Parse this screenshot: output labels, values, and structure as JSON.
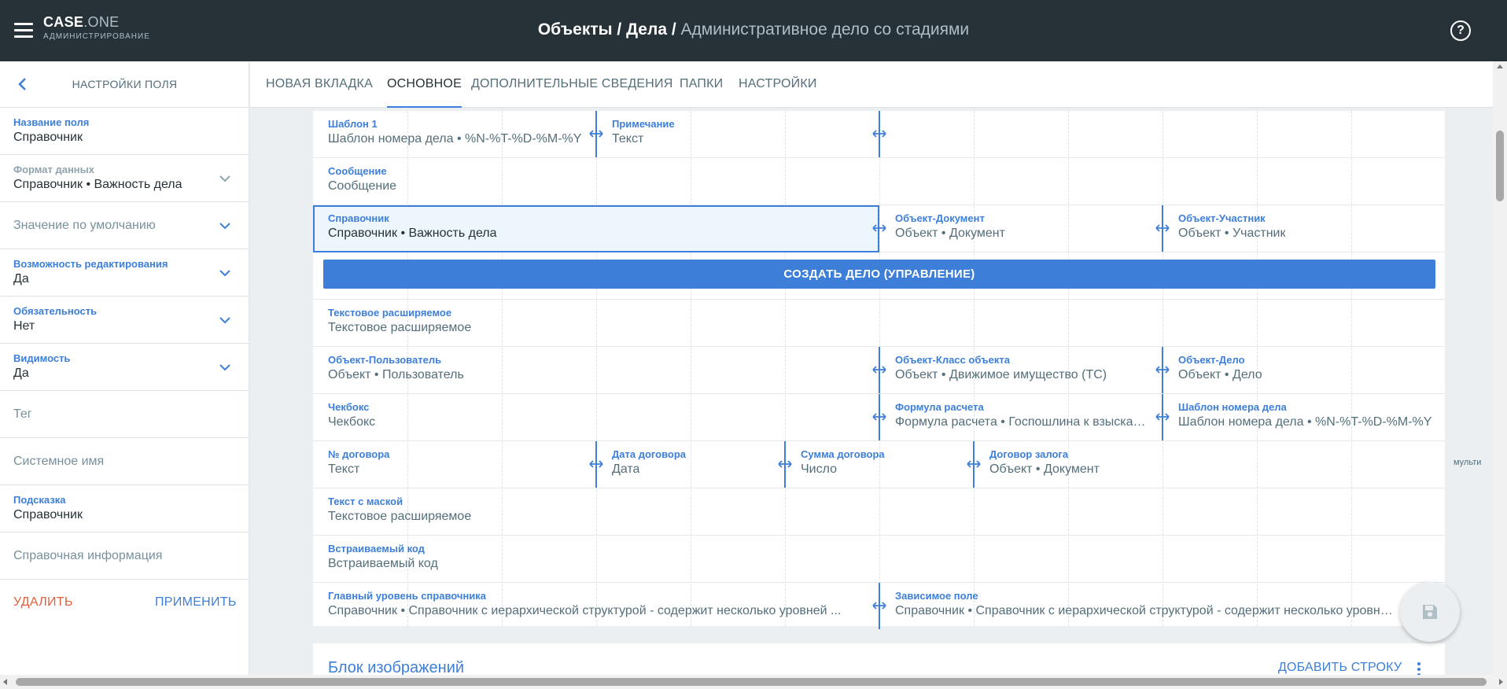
{
  "app": {
    "brand_main": "CASE",
    "brand_suffix": ".ONE",
    "brand_subtitle": "АДМИНИСТРИРОВАНИЕ"
  },
  "breadcrumb": {
    "part1": "Объекты / Дела / ",
    "current": "Административное дело со стадиями"
  },
  "sidebar": {
    "title": "НАСТРОЙКИ ПОЛЯ",
    "field_name": {
      "label": "Название поля",
      "value": "Справочник"
    },
    "data_format": {
      "label": "Формат данных",
      "value": "Справочник • Важность дела"
    },
    "default_value": {
      "label": "Значение по умолчанию"
    },
    "editable": {
      "label": "Возможность редактирования",
      "value": "Да"
    },
    "required": {
      "label": "Обязательность",
      "value": "Нет"
    },
    "visibility": {
      "label": "Видимость",
      "value": "Да"
    },
    "tag": {
      "label": "Тег"
    },
    "system_name": {
      "label": "Системное имя"
    },
    "hint": {
      "label": "Подсказка",
      "value": "Справочник"
    },
    "reference_info": {
      "label": "Справочная информация"
    },
    "delete_label": "УДАЛИТЬ",
    "apply_label": "ПРИМЕНИТЬ"
  },
  "tabs": [
    "НОВАЯ ВКЛАДКА",
    "ОСНОВНОЕ",
    "ДОПОЛНИТЕЛЬНЫЕ СВЕДЕНИЯ",
    "ПАПКИ",
    "НАСТРОЙКИ"
  ],
  "active_tab": "ОСНОВНОЕ",
  "form": {
    "template1": {
      "label": "Шаблон 1",
      "value": "Шаблон номера дела • %N-%T-%D-%M-%Y"
    },
    "note": {
      "label": "Примечание",
      "value": "Текст"
    },
    "message": {
      "label": "Сообщение",
      "value": "Сообщение"
    },
    "reference": {
      "label": "Справочник",
      "value": "Справочник • Важность дела"
    },
    "object_document": {
      "label": "Объект-Документ",
      "value": "Объект • Документ"
    },
    "object_participant": {
      "label": "Объект-Участник",
      "value": "Объект • Участник"
    },
    "create_case_button": "СОЗДАТЬ ДЕЛО (УПРАВЛЕНИЕ)",
    "text_extended": {
      "label": "Текстовое расширяемое",
      "value": "Текстовое расширяемое"
    },
    "object_user": {
      "label": "Объект-Пользователь",
      "value": "Объект • Пользователь"
    },
    "object_class": {
      "label": "Объект-Класс объекта",
      "value": "Объект • Движимое имущество (ТС)"
    },
    "object_case": {
      "label": "Объект-Дело",
      "value": "Объект • Дело"
    },
    "checkbox": {
      "label": "Чекбокс",
      "value": "Чекбокс"
    },
    "formula": {
      "label": "Формула расчета",
      "value": "Формула расчета • Госпошлина к взыскан..."
    },
    "case_number_template": {
      "label": "Шаблон номера дела",
      "value": "Шаблон номера дела • %N-%T-%D-%M-%Y"
    },
    "contract_no": {
      "label": "№ договора",
      "value": "Текст"
    },
    "contract_date": {
      "label": "Дата договора",
      "value": "Дата"
    },
    "contract_sum": {
      "label": "Сумма договора",
      "value": "Число"
    },
    "pledge_contract": {
      "label": "Договор залога",
      "value": "Объект • Документ"
    },
    "multi_label": "мульти",
    "masked_text": {
      "label": "Текст с маской",
      "value": "Текстовое расширяемое"
    },
    "embedded_code": {
      "label": "Встраиваемый код",
      "value": "Встраиваемый код"
    },
    "main_level": {
      "label": "Главный уровень справочника",
      "value": "Справочник • Справочник с иерархической структурой - содержит несколько уровней ..."
    },
    "dependent_field": {
      "label": "Зависимое поле",
      "value": "Справочник • Справочник с иерархической структурой - содержит несколько уровней ..."
    }
  },
  "image_block": {
    "title": "Блок изображений",
    "add_row_label": "ДОБАВИТЬ СТРОКУ"
  },
  "colors": {
    "header_bg": "#263238",
    "accent": "#3d7fd8",
    "danger": "#e0603a",
    "selected_bg": "#eef6fd"
  },
  "icons": {
    "menu": "hamburger-icon",
    "help": "help-circle-icon",
    "back": "chevron-left-icon",
    "expand": "chevron-down-icon",
    "resize": "resize-horizontal-icon",
    "more": "kebab-icon",
    "save": "floppy-disk-icon"
  }
}
